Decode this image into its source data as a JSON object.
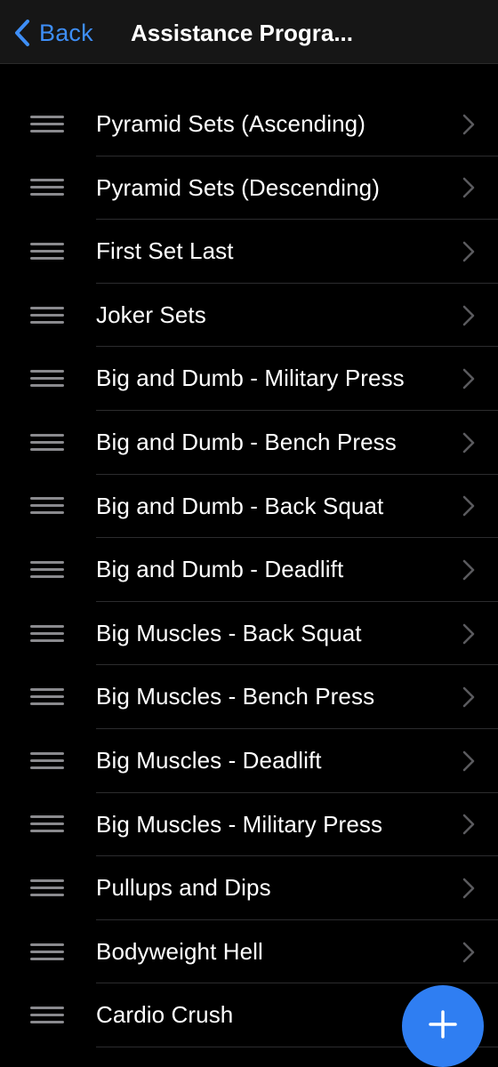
{
  "navbar": {
    "back_label": "Back",
    "title": "Assistance Progra...",
    "accent_color": "#3e8ef7",
    "back_icon": "chevron-left-icon"
  },
  "list": {
    "items": [
      {
        "label": "Pyramid Sets (Ascending)"
      },
      {
        "label": "Pyramid Sets (Descending)"
      },
      {
        "label": "First Set Last"
      },
      {
        "label": "Joker Sets"
      },
      {
        "label": "Big and Dumb - Military Press"
      },
      {
        "label": "Big and Dumb - Bench Press"
      },
      {
        "label": "Big and Dumb - Back Squat"
      },
      {
        "label": "Big and Dumb - Deadlift"
      },
      {
        "label": "Big Muscles - Back Squat"
      },
      {
        "label": "Big Muscles - Bench Press"
      },
      {
        "label": "Big Muscles - Deadlift"
      },
      {
        "label": "Big Muscles - Military Press"
      },
      {
        "label": "Pullups and Dips"
      },
      {
        "label": "Bodyweight Hell"
      },
      {
        "label": "Cardio Crush"
      }
    ],
    "row_icons": [
      "drag-handle-icon",
      "chevron-right-icon"
    ]
  },
  "fab": {
    "icon": "plus-icon",
    "color": "#2f7ef2"
  }
}
